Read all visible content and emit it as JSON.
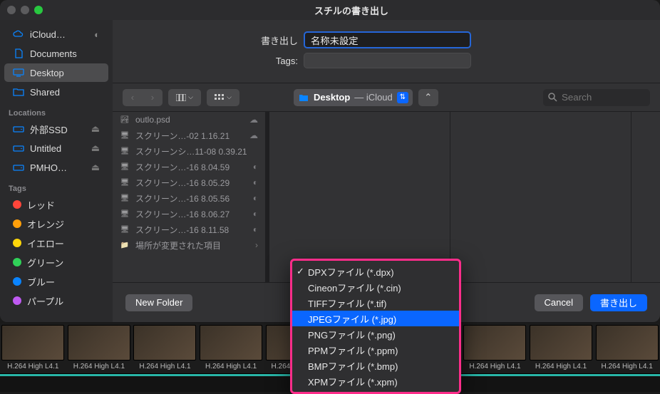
{
  "dialog": {
    "title": "スチルの書き出し",
    "save_label": "書き出し",
    "tags_label": "Tags:",
    "filename": "名称未設定",
    "location_folder": "Desktop",
    "location_suffix": "— iCloud",
    "search_placeholder": "Search",
    "new_folder_label": "New Folder",
    "cancel_label": "Cancel",
    "export_label": "書き出し"
  },
  "sidebar": {
    "favorites": [
      {
        "label": "iCloud…",
        "icon": "cloud"
      },
      {
        "label": "Documents",
        "icon": "doc"
      },
      {
        "label": "Desktop",
        "icon": "desktop",
        "selected": true
      },
      {
        "label": "Shared",
        "icon": "folder"
      }
    ],
    "locations_heading": "Locations",
    "locations": [
      {
        "label": "外部SSD",
        "icon": "drive"
      },
      {
        "label": "Untitled",
        "icon": "drive"
      },
      {
        "label": "PMHO…",
        "icon": "drive"
      }
    ],
    "tags_heading": "Tags",
    "tags": [
      {
        "label": "レッド",
        "color": "#ff453a"
      },
      {
        "label": "オレンジ",
        "color": "#ff9f0a"
      },
      {
        "label": "イエロー",
        "color": "#ffd60a"
      },
      {
        "label": "グリーン",
        "color": "#30d158"
      },
      {
        "label": "ブルー",
        "color": "#0a84ff"
      },
      {
        "label": "パープル",
        "color": "#bf5af2"
      }
    ]
  },
  "files": [
    {
      "name": "outlo.psd",
      "cloud": true,
      "icon": "image"
    },
    {
      "name": "スクリーン…-02 1.16.21",
      "cloud": true,
      "icon": "screen"
    },
    {
      "name": "スクリーンシ…11-08 0.39.21",
      "icon": "screen"
    },
    {
      "name": "スクリーン…-16 8.04.59",
      "badge": true,
      "icon": "screen"
    },
    {
      "name": "スクリーン…-16 8.05.29",
      "badge": true,
      "icon": "screen"
    },
    {
      "name": "スクリーン…-16 8.05.56",
      "badge": true,
      "icon": "screen"
    },
    {
      "name": "スクリーン…-16 8.06.27",
      "badge": true,
      "icon": "screen"
    },
    {
      "name": "スクリーン…-16 8.11.58",
      "badge": true,
      "icon": "screen"
    },
    {
      "name": "場所が変更された項目",
      "icon": "folder",
      "chev": true
    }
  ],
  "dropdown": {
    "items": [
      {
        "label": "DPXファイル (*.dpx)",
        "checked": true
      },
      {
        "label": "Cineonファイル (*.cin)"
      },
      {
        "label": "TIFFファイル (*.tif)"
      },
      {
        "label": "JPEGファイル (*.jpg)",
        "selected": true
      },
      {
        "label": "PNGファイル (*.png)"
      },
      {
        "label": "PPMファイル (*.ppm)"
      },
      {
        "label": "BMPファイル (*.bmp)"
      },
      {
        "label": "XPMファイル (*.xpm)"
      }
    ]
  },
  "thumb_label": "H.264 High L4.1"
}
